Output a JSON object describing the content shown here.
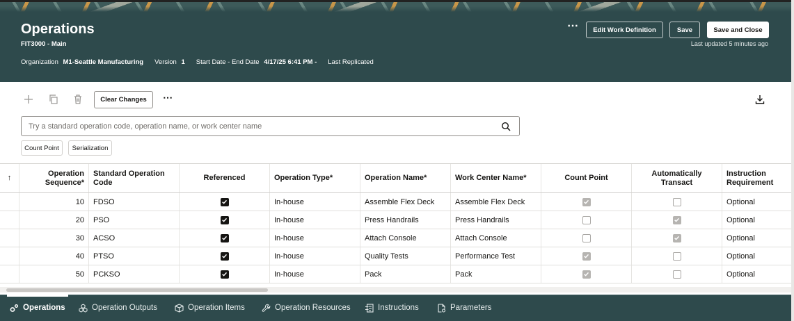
{
  "header": {
    "title": "Operations",
    "subtitle": "FIT3000 - Main",
    "organization_label": "Organization",
    "organization_value": "M1-Seattle Manufacturing",
    "version_label": "Version",
    "version_value": "1",
    "dates_label": "Start Date - End Date",
    "dates_value": "4/17/25 6:41 PM -",
    "last_replicated_label": "Last Replicated",
    "more_label": "⋯",
    "edit_label": "Edit Work Definition",
    "save_label": "Save",
    "save_close_label": "Save and Close",
    "last_updated": "Last updated 5 minutes ago",
    "background_color": "#2e4a4c"
  },
  "toolbar": {
    "icons": [
      "plus-icon",
      "duplicate-icon",
      "trash-icon",
      "download-icon"
    ],
    "clear_label": "Clear Changes",
    "more_label": "⋯"
  },
  "search": {
    "placeholder": "Try a standard operation code, operation name, or work center name",
    "value": ""
  },
  "chips": [
    "Count Point",
    "Serialization"
  ],
  "table": {
    "sort_indicator": "↑",
    "columns": [
      "Operation Sequence*",
      "Standard Operation Code",
      "Referenced",
      "Operation Type*",
      "Operation Name*",
      "Work Center Name*",
      "Count Point",
      "Automatically Transact",
      "Instruction Requirement"
    ],
    "rows": [
      {
        "seq": "10",
        "code": "FDSO",
        "referenced": true,
        "type": "In-house",
        "name": "Assemble Flex Deck",
        "work_center": "Assemble Flex Deck",
        "count_point": true,
        "auto_transact": false,
        "instruction": "Optional"
      },
      {
        "seq": "20",
        "code": "PSO",
        "referenced": true,
        "type": "In-house",
        "name": "Press Handrails",
        "work_center": "Press Handrails",
        "count_point": false,
        "auto_transact": true,
        "instruction": "Optional"
      },
      {
        "seq": "30",
        "code": "ACSO",
        "referenced": true,
        "type": "In-house",
        "name": "Attach Console",
        "work_center": "Attach Console",
        "count_point": false,
        "auto_transact": true,
        "instruction": "Optional"
      },
      {
        "seq": "40",
        "code": "PTSO",
        "referenced": true,
        "type": "In-house",
        "name": "Quality Tests",
        "work_center": "Performance Test",
        "count_point": true,
        "auto_transact": false,
        "instruction": "Optional"
      },
      {
        "seq": "50",
        "code": "PCKSO",
        "referenced": true,
        "type": "In-house",
        "name": "Pack",
        "work_center": "Pack",
        "count_point": true,
        "auto_transact": false,
        "instruction": "Optional"
      }
    ]
  },
  "tabs": [
    {
      "label": "Operations",
      "icon": "gears-icon",
      "active": true
    },
    {
      "label": "Operation Outputs",
      "icon": "cubes-icon",
      "active": false
    },
    {
      "label": "Operation Items",
      "icon": "box-icon",
      "active": false
    },
    {
      "label": "Operation Resources",
      "icon": "wrench-icon",
      "active": false
    },
    {
      "label": "Instructions",
      "icon": "instructions-icon",
      "active": false
    },
    {
      "label": "Parameters",
      "icon": "document-settings-icon",
      "active": false
    }
  ]
}
